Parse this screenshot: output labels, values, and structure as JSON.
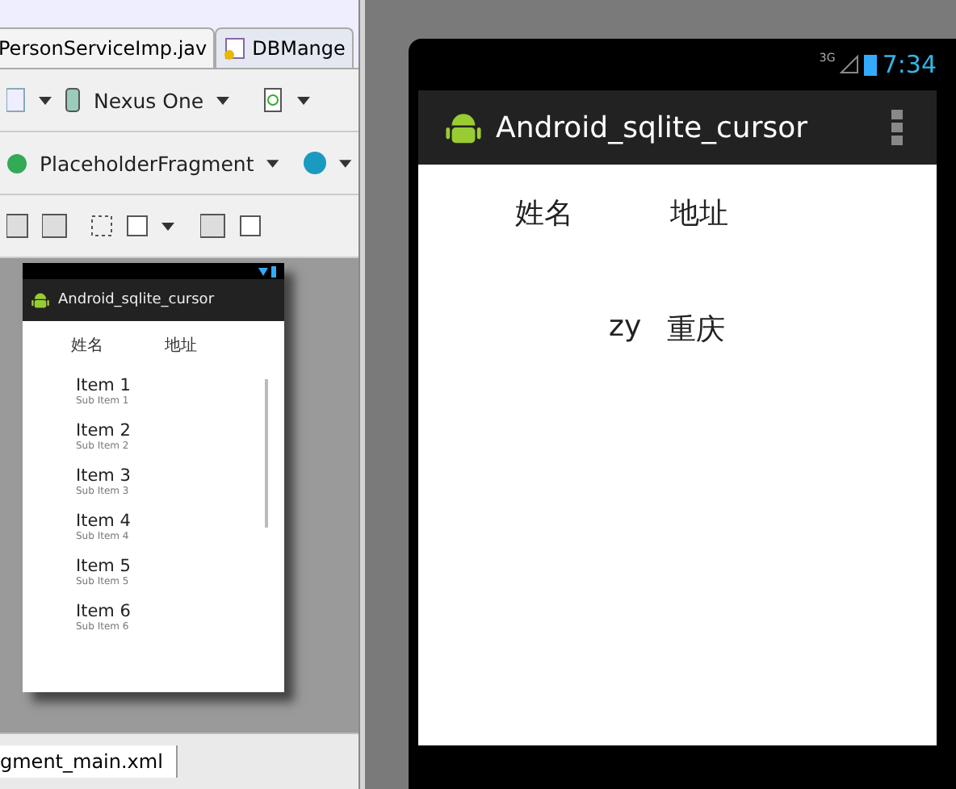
{
  "editor": {
    "tabs": [
      {
        "label": "PersonServiceImp.jav",
        "selected": true
      },
      {
        "label": "DBMange",
        "selected": false
      }
    ],
    "device": "Nexus One",
    "fragment": "PlaceholderFragment",
    "preview": {
      "app_title": "Android_sqlite_cursor",
      "headers": [
        "姓名",
        "地址"
      ],
      "items": [
        {
          "title": "Item 1",
          "subtitle": "Sub Item 1"
        },
        {
          "title": "Item 2",
          "subtitle": "Sub Item 2"
        },
        {
          "title": "Item 3",
          "subtitle": "Sub Item 3"
        },
        {
          "title": "Item 4",
          "subtitle": "Sub Item 4"
        },
        {
          "title": "Item 5",
          "subtitle": "Sub Item 5"
        },
        {
          "title": "Item 6",
          "subtitle": "Sub Item 6"
        }
      ]
    },
    "bottom_tab": "gment_main.xml"
  },
  "emulator": {
    "network": "3G",
    "time": "7:34",
    "app_title": "Android_sqlite_cursor",
    "headers": [
      "姓名",
      "地址"
    ],
    "rows": [
      {
        "name": "zy",
        "address": "重庆"
      }
    ]
  }
}
